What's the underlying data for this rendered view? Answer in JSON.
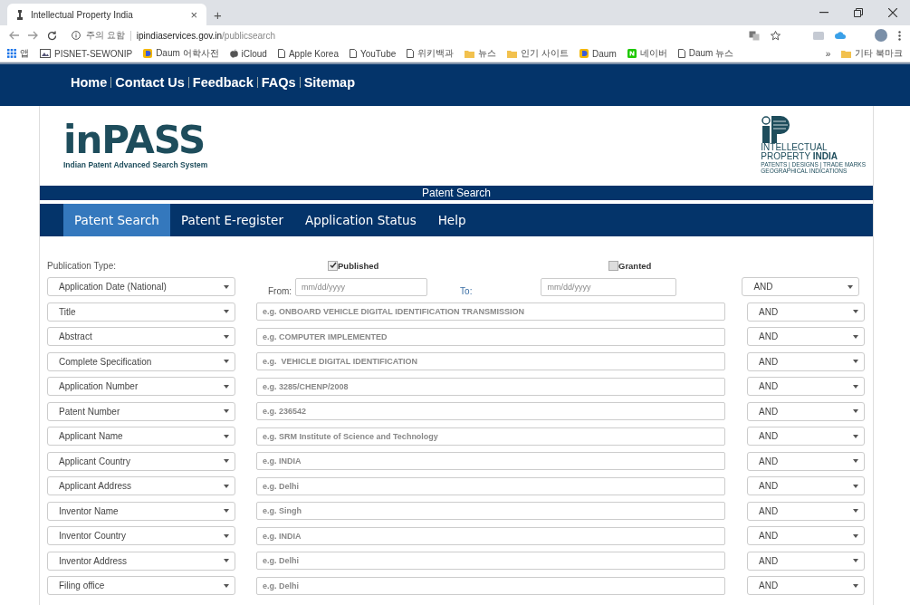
{
  "browser": {
    "tab_title": "Intellectual Property India",
    "tab_close": "×",
    "new_tab": "+",
    "security_label": "주의 요함",
    "url_host": "ipindiaservices.gov.in",
    "url_path": "/publicsearch",
    "bookmarks": [
      {
        "label": "앱",
        "kind": "apps"
      },
      {
        "label": "PISNET-SEWONIP",
        "kind": "image"
      },
      {
        "label": "Daum 어학사전",
        "kind": "daum"
      },
      {
        "label": "iCloud",
        "kind": "apple"
      },
      {
        "label": "Apple Korea",
        "kind": "page"
      },
      {
        "label": "YouTube",
        "kind": "page"
      },
      {
        "label": "위키백과",
        "kind": "page"
      },
      {
        "label": "뉴스",
        "kind": "folder"
      },
      {
        "label": "인기 사이트",
        "kind": "folder"
      },
      {
        "label": "Daum",
        "kind": "daum"
      },
      {
        "label": "네이버",
        "kind": "naver"
      },
      {
        "label": "Daum 뉴스",
        "kind": "page"
      }
    ],
    "more_bookmarks": "»",
    "other_bookmarks": "기타 북마크"
  },
  "top_nav": [
    "Home",
    "Contact Us",
    "Feedback",
    "FAQs",
    "Sitemap"
  ],
  "logo": {
    "name": "inPASS",
    "tagline": "Indian Patent Advanced Search System"
  },
  "ip_logo": {
    "line_1": "INTELLECTUAL",
    "line_2": "PROPERTY **INDIA**",
    "line_3": "PATENTS | DESIGNS | TRADE MARKS",
    "line_4": "GEOGRAPHICAL INDICATIONS"
  },
  "section_title": "Patent Search",
  "nav_tabs": [
    {
      "label": "Patent Search",
      "selected": true
    },
    {
      "label": "Patent E-register",
      "selected": false
    },
    {
      "label": "Application Status",
      "selected": false
    },
    {
      "label": "Help",
      "selected": false
    }
  ],
  "form": {
    "publication_type": {
      "label": "Publication Type:",
      "options": [
        {
          "label": "Published",
          "checked": true
        },
        {
          "label": "Granted",
          "checked": false
        }
      ]
    },
    "date_row": {
      "field": "Application Date (National)",
      "from_label": "From:",
      "from_placeholder": "mm/dd/yyyy",
      "to_label": "To:",
      "to_placeholder": "mm/dd/yyyy",
      "operator": "AND"
    },
    "rows": [
      {
        "field": "Title",
        "placeholder": "e.g. ONBOARD VEHICLE DIGITAL IDENTIFICATION TRANSMISSION",
        "operator": "AND"
      },
      {
        "field": "Abstract",
        "placeholder": "e.g. COMPUTER IMPLEMENTED",
        "operator": "AND"
      },
      {
        "field": "Complete Specification",
        "placeholder": "e.g.  VEHICLE DIGITAL IDENTIFICATION",
        "operator": "AND"
      },
      {
        "field": "Application Number",
        "placeholder": "e.g. 3285/CHENP/2008",
        "operator": "AND"
      },
      {
        "field": "Patent Number",
        "placeholder": "e.g. 236542",
        "operator": "AND"
      },
      {
        "field": "Applicant Name",
        "placeholder": "e.g. SRM Institute of Science and Technology",
        "operator": "AND"
      },
      {
        "field": "Applicant Country",
        "placeholder": "e.g. INDIA",
        "operator": "AND"
      },
      {
        "field": "Applicant Address",
        "placeholder": "e.g. Delhi",
        "operator": "AND"
      },
      {
        "field": "Inventor Name",
        "placeholder": "e.g. Singh",
        "operator": "AND"
      },
      {
        "field": "Inventor Country",
        "placeholder": "e.g. INDIA",
        "operator": "AND"
      },
      {
        "field": "Inventor Address",
        "placeholder": "e.g. Delhi",
        "operator": "AND"
      },
      {
        "field": "Filing office",
        "placeholder": "e.g. Delhi",
        "operator": "AND"
      }
    ]
  }
}
